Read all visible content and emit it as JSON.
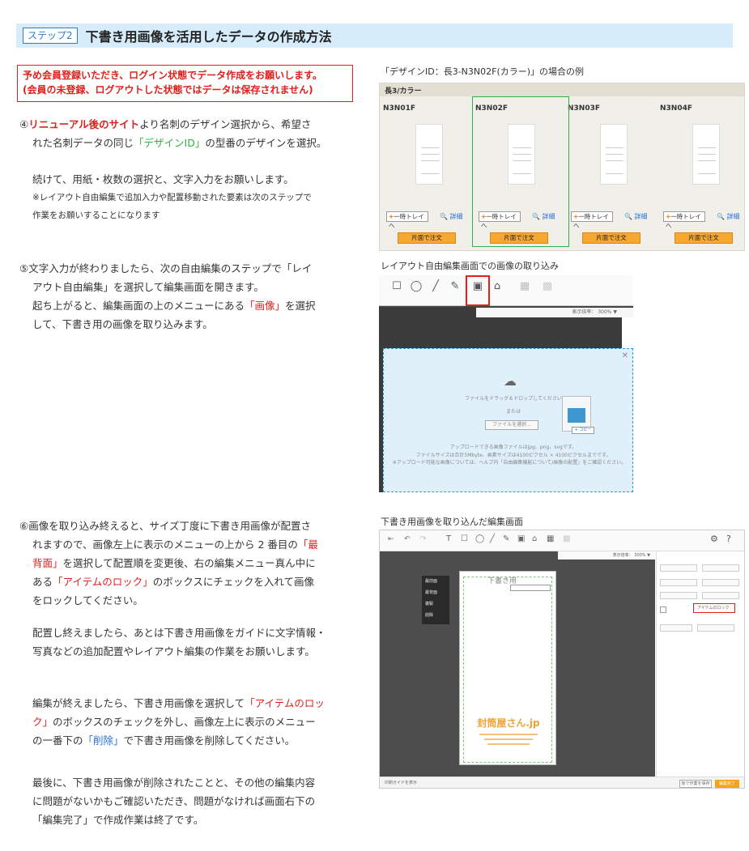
{
  "header": {
    "badge": "ステップ2",
    "title": "下書き用画像を活用したデータの作成方法"
  },
  "notice": {
    "line1": "予め会員登録いただき、ログイン状態でデータ作成をお願いします。",
    "line2": "(会員の未登録、ログアウトした状態ではデータは保存されません)"
  },
  "step4": {
    "num": "④",
    "highlight": "リニューアル後のサイト",
    "text1": "より名刺のデザイン選択から、希望さ",
    "text2a": "れた名刺データの同じ",
    "designid": "「デザインID」",
    "text2b": "の型番のデザインを選択。",
    "cont1": "続けて、用紙・枚数の選択と、文字入力をお願いします。",
    "note1": "※レイアウト自由編集で追加入力や配置移動された要素は次のステップで",
    "note2": "作業をお願いすることになります"
  },
  "step5": {
    "line1": "⑤文字入力が終わりましたら、次の自由編集のステップで「レイ",
    "line2": "アウト自由編集」を選択して編集画面を開きます。",
    "line3a": "起ち上がると、編集画面の上のメニューにある",
    "line3b": "「画像」",
    "line3c": "を選択",
    "line4": "して、下書き用の画像を取り込みます。"
  },
  "step6": {
    "l1a": "⑥画像を取り込み終えると、サイズ丁度に下書き用画像が配置さ",
    "l2a": "れますので、画像左上に表示のメニューの上から 2 番目の",
    "l2b": "「最",
    "l3a": "背面」",
    "l3b": "を選択して配置順を変更後、右の編集メニュー真ん中に",
    "l4a": "ある",
    "l4b": "「アイテムのロック」",
    "l4c": "のボックスにチェックを入れて画像",
    "l5": "をロックしてください。",
    "p2l1": "配置し終えましたら、あとは下書き用画像をガイドに文字情報・",
    "p2l2": "写真などの追加配置やレイアウト編集の作業をお願いします。",
    "p3l1a": "編集が終えましたら、下書き用画像を選択して",
    "p3l1b": "「アイテムのロッ",
    "p3l2a": "ク」",
    "p3l2b": "のボックスのチェックを外し、画像左上に表示のメニュー",
    "p3l3a": "の一番下の",
    "p3l3b": "「削除」",
    "p3l3c": "で下書き用画像を削除してください。",
    "p4l1": "最後に、下書き用画像が削除されたことと、その他の編集内容",
    "p4l2": "に問題がないかもご確認いただき、問題がなければ画面右下の",
    "p4l3": "「編集完了」で作成作業は終了です。"
  },
  "captions": {
    "c1": "「デザインID：長3-N3N02F(カラー)」の場合の例",
    "c2": "レイアウト自由編集画面での画像の取り込み",
    "c3": "下書き用画像を取り込んだ編集画面"
  },
  "shot1": {
    "bar": "長3/カラー",
    "cards": [
      {
        "code": "N3N01F"
      },
      {
        "code": "N3N02F"
      },
      {
        "code": "N3N03F"
      },
      {
        "code": "N3N04F"
      }
    ],
    "temp_btn": "一時トレイへ",
    "detail": "詳細",
    "order_btn": "片面で注文"
  },
  "shot2": {
    "zoom": "表示倍率： 300% ▼",
    "drop1": "ファイルをドラッグ＆ドロップしてください",
    "drop2": "または",
    "select_btn": "ファイルを選択...",
    "copy": "+ コピー",
    "info1": "アップロードできる画像ファイルはjpg、png、svgです。",
    "info2": "ファイルサイズは合計5Mbyte、画素サイズは4100ピクセル × 4100ピクセルまでです。",
    "info3": "※アップロード可能な画像については、ヘルプ内「自由編集機能について/画像の配置」をご確認ください。"
  },
  "shot3": {
    "zoom": "表示倍率： 300% ▼",
    "menu": [
      "最前面",
      "最背面",
      "複製",
      "削除"
    ],
    "draft_label": "下書き用",
    "logo": "封筒屋さん.jp",
    "lock_label": "アイテムのロック",
    "done": "編集完了",
    "later": "後で作業を保存",
    "bottom_left": "印刷ガイドを表示"
  }
}
